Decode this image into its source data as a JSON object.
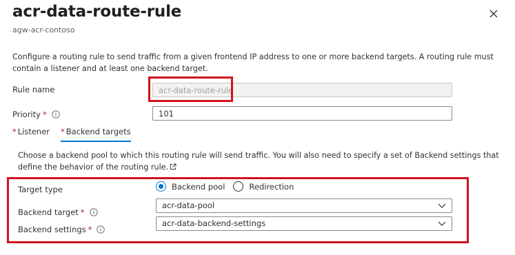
{
  "header": {
    "title": "acr-data-route-rule",
    "subtitle": "agw-acr-contoso"
  },
  "description": "Configure a routing rule to send traffic from a given frontend IP address to one or more backend targets. A routing rule must contain a listener and at least one backend target.",
  "form": {
    "rule_name_label": "Rule name",
    "rule_name_value": "acr-data-route-rule",
    "priority_label": "Priority",
    "priority_value": "101",
    "required_mark": "*"
  },
  "tabs": [
    {
      "label": "Listener",
      "active": false
    },
    {
      "label": "Backend targets",
      "active": true
    }
  ],
  "backend": {
    "description": "Choose a backend pool to which this routing rule will send traffic. You will also need to specify a set of Backend settings that define the behavior of the routing rule.",
    "target_type_label": "Target type",
    "target_type_options": [
      "Backend pool",
      "Redirection"
    ],
    "target_type_selected": "Backend pool",
    "backend_target_label": "Backend target",
    "backend_target_value": "acr-data-pool",
    "backend_settings_label": "Backend settings",
    "backend_settings_value": "acr-data-backend-settings"
  },
  "colors": {
    "accent": "#0078d4",
    "highlight": "#d0121d",
    "required": "#a4262c"
  },
  "icons": [
    "close-icon",
    "info-icon",
    "external-link-icon",
    "chevron-down-icon"
  ]
}
